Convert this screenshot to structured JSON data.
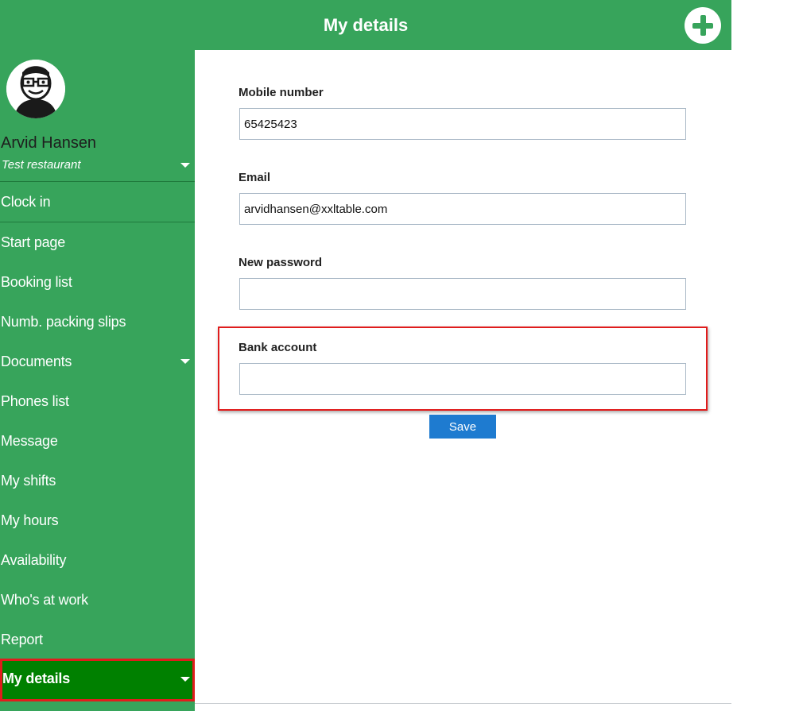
{
  "header": {
    "title": "My details",
    "add_icon": "plus-circle-icon"
  },
  "user": {
    "name": "Arvid Hansen",
    "restaurant": "Test restaurant",
    "avatar_icon": "user-avatar-icon"
  },
  "sidebar": {
    "clock_in": "Clock in",
    "items": [
      {
        "label": "Start page"
      },
      {
        "label": "Booking list"
      },
      {
        "label": "Numb. packing slips"
      },
      {
        "label": "Documents"
      },
      {
        "label": "Phones list"
      },
      {
        "label": "Message"
      },
      {
        "label": "My shifts"
      },
      {
        "label": "My hours"
      },
      {
        "label": "Availability"
      },
      {
        "label": "Who's at work"
      },
      {
        "label": "Report"
      },
      {
        "label": "My details"
      }
    ]
  },
  "form": {
    "mobile_label": "Mobile number",
    "mobile_value": "65425423",
    "email_label": "Email",
    "email_value": "arvidhansen@xxltable.com",
    "password_label": "New password",
    "password_value": "",
    "bank_label": "Bank account",
    "bank_value": "",
    "save_label": "Save"
  },
  "colors": {
    "sidebar_bg": "#37a45b",
    "active_item_bg": "#008000",
    "highlight": "#e01c1c",
    "save_button": "#1e7bd0"
  }
}
